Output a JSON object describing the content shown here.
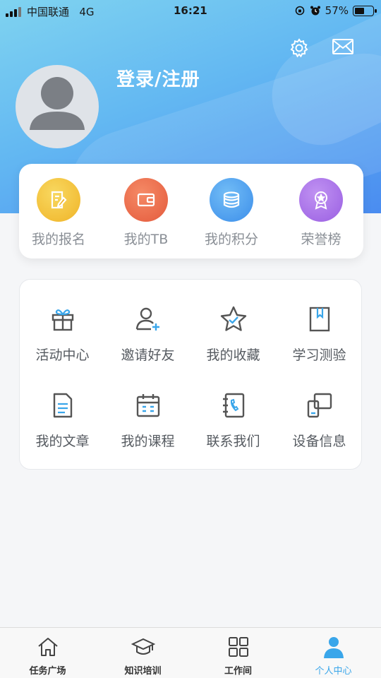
{
  "status_bar": {
    "carrier": "中国联通",
    "network": "4G",
    "time": "16:21",
    "battery": "57%",
    "battery_level": 0.57
  },
  "header": {
    "login_text": "登录/注册"
  },
  "quick_actions": [
    {
      "label": "我的报名",
      "icon": "signup-icon",
      "color": "#f2c230"
    },
    {
      "label": "我的TB",
      "icon": "wallet-icon",
      "color": "#ee6a4a"
    },
    {
      "label": "我的积分",
      "icon": "coins-icon",
      "color": "#4a9ff0"
    },
    {
      "label": "荣誉榜",
      "icon": "medal-icon",
      "color": "#a66de8"
    }
  ],
  "grid_items": [
    {
      "label": "活动中心",
      "icon": "gift-icon"
    },
    {
      "label": "邀请好友",
      "icon": "add-user-icon"
    },
    {
      "label": "我的收藏",
      "icon": "star-icon"
    },
    {
      "label": "学习测验",
      "icon": "book-icon"
    },
    {
      "label": "我的文章",
      "icon": "document-icon"
    },
    {
      "label": "我的课程",
      "icon": "calendar-icon"
    },
    {
      "label": "联系我们",
      "icon": "contact-book-icon"
    },
    {
      "label": "设备信息",
      "icon": "devices-icon"
    }
  ],
  "tabs": [
    {
      "label": "任务广场",
      "icon": "home-icon",
      "active": false
    },
    {
      "label": "知识培训",
      "icon": "graduation-cap-icon",
      "active": false
    },
    {
      "label": "工作间",
      "icon": "grid-icon",
      "active": false
    },
    {
      "label": "个人中心",
      "icon": "person-icon",
      "active": true
    }
  ],
  "colors": {
    "accent": "#3aa6ea",
    "header_start": "#7fd3f0",
    "header_end": "#4a8cf0"
  }
}
